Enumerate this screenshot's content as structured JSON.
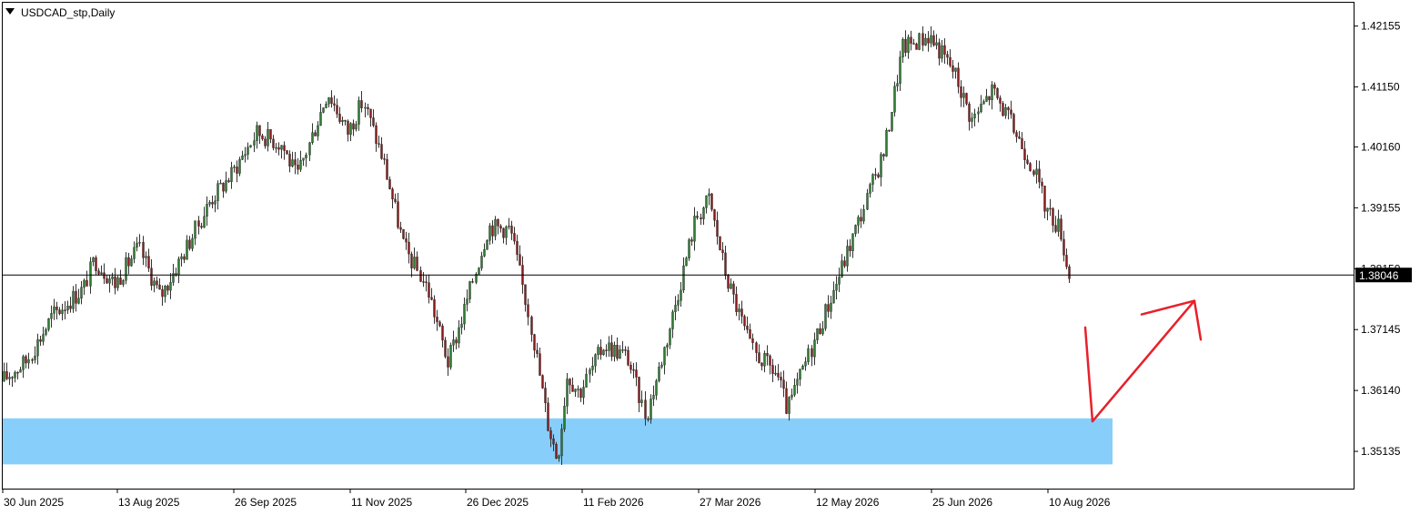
{
  "window": {
    "symbol_label": "USDCAD_stp,Daily"
  },
  "current_price": {
    "label": "1.38046",
    "value": 1.38046
  },
  "chart_data": {
    "type": "candlestick",
    "title": "USDCAD_stp,Daily",
    "x_ticks": [
      "30 Jun 2025",
      "13 Aug 2025",
      "26 Sep 2025",
      "11 Nov 2025",
      "26 Dec 2025",
      "11 Feb 2026",
      "27 Mar 2026",
      "12 May 2026",
      "25 Jun 2026",
      "10 Aug 2026"
    ],
    "y_ticks": [
      "1.42155",
      "1.41150",
      "1.40160",
      "1.39155",
      "1.38150",
      "1.37145",
      "1.36140",
      "1.35135"
    ],
    "y_tick_values": [
      1.42155,
      1.4115,
      1.4016,
      1.39155,
      1.3815,
      1.37145,
      1.3614,
      1.35135
    ],
    "ylim": [
      1.3452,
      1.4254
    ],
    "colors": {
      "bull_candle": "#2e7d32",
      "bear_candle": "#8b1a1a",
      "support_zone": "#87cefa",
      "projection_arrow": "#e8202a",
      "price_line": "#000000"
    },
    "support_zone": {
      "low": 1.3492,
      "high": 1.3568,
      "label": ""
    },
    "projection_path": [
      {
        "x": "10 Aug 2026",
        "price": 1.3718
      },
      {
        "x": "10 Aug 2026",
        "price": 1.3563
      },
      {
        "x": "25 Aug 2026",
        "price": 1.3762
      },
      {
        "x": "2 Sep 2026",
        "price": 1.3698
      }
    ],
    "close_series": [
      {
        "date": "30 Jun 2025",
        "close": 1.3628
      },
      {
        "date": "10 Jul 2025",
        "close": 1.3662
      },
      {
        "date": "20 Jul 2025",
        "close": 1.3738
      },
      {
        "date": "1 Aug 2025",
        "close": 1.3782
      },
      {
        "date": "5 Aug 2025",
        "close": 1.383
      },
      {
        "date": "13 Aug 2025",
        "close": 1.379
      },
      {
        "date": "22 Aug 2025",
        "close": 1.385
      },
      {
        "date": "30 Aug 2025",
        "close": 1.3768
      },
      {
        "date": "8 Sep 2025",
        "close": 1.384
      },
      {
        "date": "18 Sep 2025",
        "close": 1.3928
      },
      {
        "date": "26 Sep 2025",
        "close": 1.397
      },
      {
        "date": "6 Oct 2025",
        "close": 1.404
      },
      {
        "date": "16 Oct 2025",
        "close": 1.402
      },
      {
        "date": "22 Oct 2025",
        "close": 1.3965
      },
      {
        "date": "3 Nov 2025",
        "close": 1.4108
      },
      {
        "date": "11 Nov 2025",
        "close": 1.404
      },
      {
        "date": "17 Nov 2025",
        "close": 1.4092
      },
      {
        "date": "25 Nov 2025",
        "close": 1.399
      },
      {
        "date": "3 Dec 2025",
        "close": 1.385
      },
      {
        "date": "12 Dec 2025",
        "close": 1.3782
      },
      {
        "date": "20 Dec 2025",
        "close": 1.366
      },
      {
        "date": "26 Dec 2025",
        "close": 1.374
      },
      {
        "date": "5 Jan 2026",
        "close": 1.3885
      },
      {
        "date": "14 Jan 2026",
        "close": 1.388
      },
      {
        "date": "22 Jan 2026",
        "close": 1.373
      },
      {
        "date": "29 Jan 2026",
        "close": 1.356
      },
      {
        "date": "2 Feb 2026",
        "close": 1.35
      },
      {
        "date": "6 Feb 2026",
        "close": 1.364
      },
      {
        "date": "11 Feb 2026",
        "close": 1.361
      },
      {
        "date": "20 Feb 2026",
        "close": 1.369
      },
      {
        "date": "1 Mar 2026",
        "close": 1.367
      },
      {
        "date": "8 Mar 2026",
        "close": 1.357
      },
      {
        "date": "16 Mar 2026",
        "close": 1.37
      },
      {
        "date": "27 Mar 2026",
        "close": 1.39
      },
      {
        "date": "1 Apr 2026",
        "close": 1.393
      },
      {
        "date": "8 Apr 2026",
        "close": 1.38
      },
      {
        "date": "18 Apr 2026",
        "close": 1.368
      },
      {
        "date": "28 Apr 2026",
        "close": 1.364
      },
      {
        "date": "2 May 2026",
        "close": 1.358
      },
      {
        "date": "12 May 2026",
        "close": 1.369
      },
      {
        "date": "20 May 2026",
        "close": 1.378
      },
      {
        "date": "30 May 2026",
        "close": 1.39
      },
      {
        "date": "8 Jun 2026",
        "close": 1.401
      },
      {
        "date": "15 Jun 2026",
        "close": 1.418
      },
      {
        "date": "25 Jun 2026",
        "close": 1.42
      },
      {
        "date": "5 Jul 2026",
        "close": 1.414
      },
      {
        "date": "12 Jul 2026",
        "close": 1.406
      },
      {
        "date": "20 Jul 2026",
        "close": 1.411
      },
      {
        "date": "28 Jul 2026",
        "close": 1.405
      },
      {
        "date": "5 Aug 2026",
        "close": 1.3985
      },
      {
        "date": "10 Aug 2026",
        "close": 1.3915
      },
      {
        "date": "16 Aug 2026",
        "close": 1.388
      },
      {
        "date": "19 Aug 2026",
        "close": 1.3805
      }
    ]
  }
}
